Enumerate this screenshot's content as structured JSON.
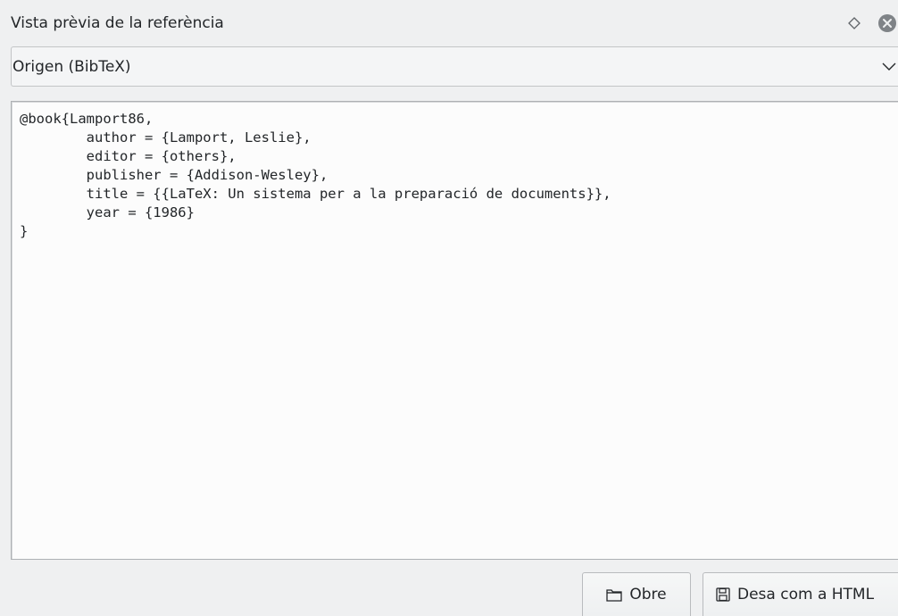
{
  "titlebar": {
    "title": "Vista prèvia de la referència",
    "float_icon": "diamond-float-icon",
    "close_icon": "close-circle-icon"
  },
  "selector": {
    "value": "Origen (BibTeX)",
    "icon": "chevron-down-icon"
  },
  "source": {
    "text": "@book{Lamport86,\n\tauthor = {Lamport, Leslie},\n\teditor = {others},\n\tpublisher = {Addison-Wesley},\n\ttitle = {{LaTeX: Un sistema per a la preparació de documents}},\n\tyear = {1986}\n}"
  },
  "buttons": {
    "open_label": "Obre",
    "open_icon": "folder-icon",
    "save_label": "Desa com a HTML",
    "save_icon": "floppy-disk-icon"
  },
  "colors": {
    "window_bg": "#eff0f1",
    "text": "#232629",
    "border": "#c3c5c7",
    "close_icon": "#7f8387"
  }
}
